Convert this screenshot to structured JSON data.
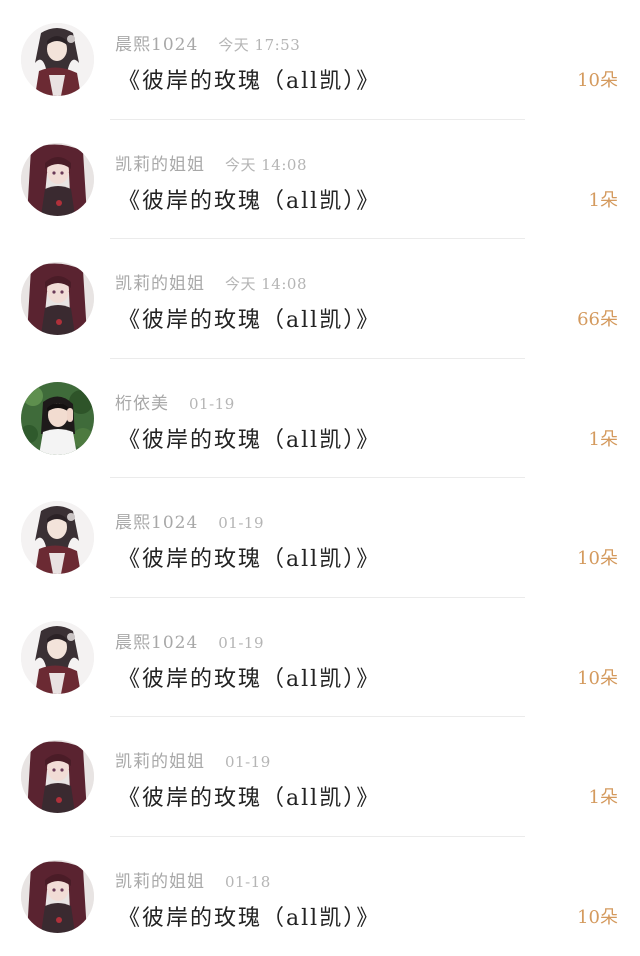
{
  "gift_list": {
    "items": [
      {
        "name": "晨熙1024",
        "time": "今天 17:53",
        "title": "《彼岸的玫瑰（all凯）》",
        "count": "10朵",
        "avatar": "anime-girl-dark-hair-icon"
      },
      {
        "name": "凯莉的姐姐",
        "time": "今天 14:08",
        "title": "《彼岸的玫瑰（all凯）》",
        "count": "1朵",
        "avatar": "anime-girl-maroon-hair-icon"
      },
      {
        "name": "凯莉的姐姐",
        "time": "今天 14:08",
        "title": "《彼岸的玫瑰（all凯）》",
        "count": "66朵",
        "avatar": "anime-girl-maroon-hair-icon"
      },
      {
        "name": "桁依美",
        "time": "01-19",
        "title": "《彼岸的玫瑰（all凯）》",
        "count": "1朵",
        "avatar": "girl-green-leaves-photo-icon"
      },
      {
        "name": "晨熙1024",
        "time": "01-19",
        "title": "《彼岸的玫瑰（all凯）》",
        "count": "10朵",
        "avatar": "anime-girl-dark-hair-icon"
      },
      {
        "name": "晨熙1024",
        "time": "01-19",
        "title": "《彼岸的玫瑰（all凯）》",
        "count": "10朵",
        "avatar": "anime-girl-dark-hair-icon"
      },
      {
        "name": "凯莉的姐姐",
        "time": "01-19",
        "title": "《彼岸的玫瑰（all凯）》",
        "count": "1朵",
        "avatar": "anime-girl-maroon-hair-icon"
      },
      {
        "name": "凯莉的姐姐",
        "time": "01-18",
        "title": "《彼岸的玫瑰（all凯）》",
        "count": "10朵",
        "avatar": "anime-girl-maroon-hair-icon"
      }
    ]
  },
  "colors": {
    "name_text": "#a8a8a8",
    "time_text": "#b5b5b5",
    "title_text": "#222222",
    "count_text": "#d49a5e",
    "divider": "#ebebeb"
  }
}
